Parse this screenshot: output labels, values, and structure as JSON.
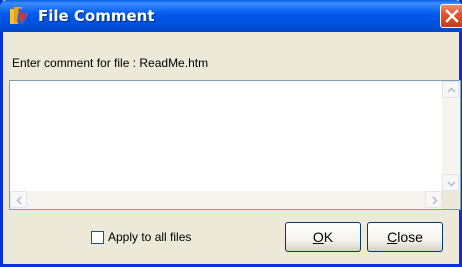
{
  "window": {
    "title": "File Comment",
    "icons": {
      "app": "file-comment-app-icon",
      "close": "close-icon"
    }
  },
  "prompt": "Enter comment for file : ReadMe.htm",
  "comment": {
    "value": ""
  },
  "apply_all": {
    "label": "Apply to all files",
    "checked": false
  },
  "buttons": {
    "ok": {
      "mnemonic": "O",
      "rest": "K"
    },
    "close": {
      "mnemonic": "C",
      "rest": "lose"
    }
  },
  "colors": {
    "titlebar": "#0058ee",
    "frame": "#0831d9",
    "close_button": "#e0512c",
    "dialog_bg": "#ece9d8"
  }
}
